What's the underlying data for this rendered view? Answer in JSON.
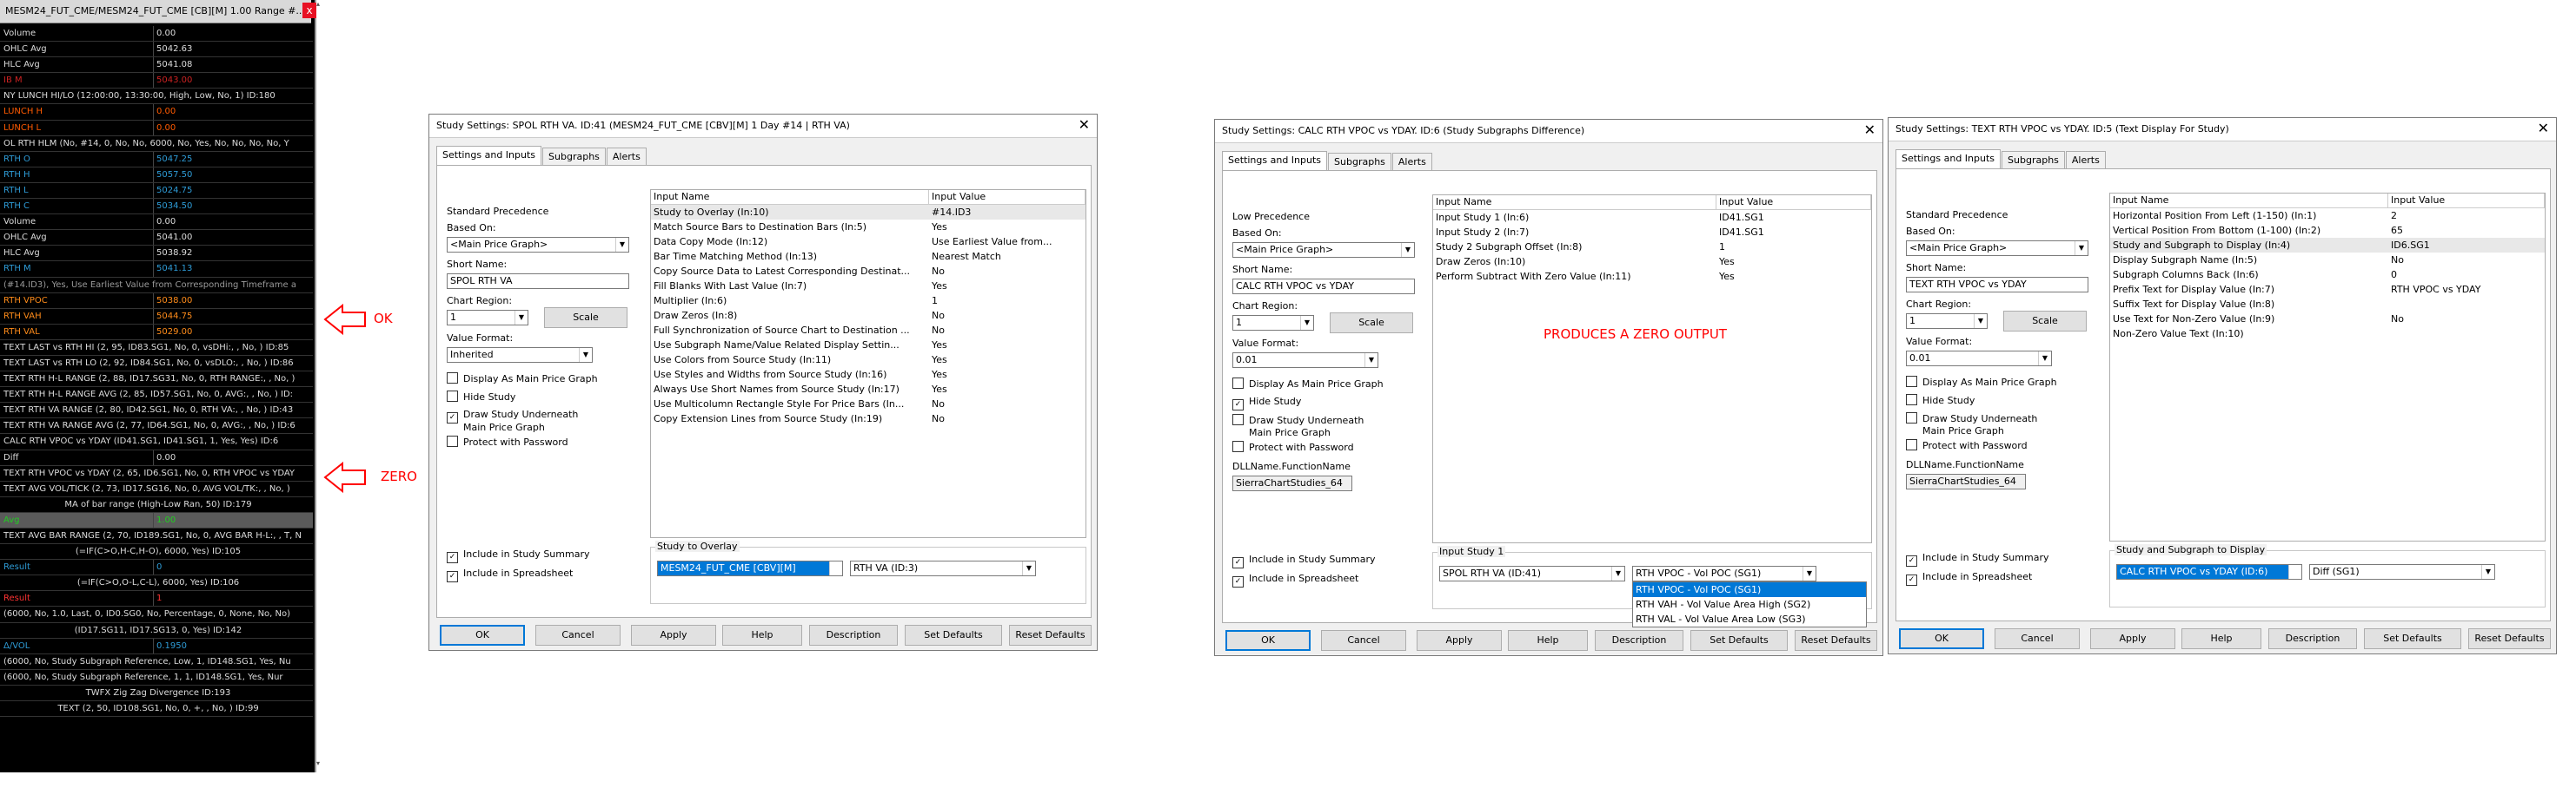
{
  "data_window": {
    "title": "MESM24_FUT_CME/MESM24_FUT_CME [CB][M] 1.00 Range #...",
    "close_label": "x",
    "rows": [
      {
        "name": "Volume",
        "value": "0.00",
        "nc": "#dcdcdc",
        "vc": "#dcdcdc"
      },
      {
        "name": "OHLC Avg",
        "value": "5042.63",
        "nc": "#dcdcdc",
        "vc": "#dcdcdc"
      },
      {
        "name": "HLC Avg",
        "value": "5041.08",
        "nc": "#dcdcdc",
        "vc": "#dcdcdc"
      },
      {
        "name": "IB M",
        "value": "5043.00",
        "nc": "#cc2222",
        "vc": "#cc2222"
      },
      {
        "name": "NY LUNCH HI/LO (12:00:00, 13:30:00, High, Low, No, 1)  ID:180",
        "value": "",
        "nc": "#dcdcdc",
        "vc": "#dcdcdc",
        "full": true
      },
      {
        "name": "LUNCH H",
        "value": "0.00",
        "nc": "#ff5a00",
        "vc": "#ff5a00"
      },
      {
        "name": "LUNCH L",
        "value": "0.00",
        "nc": "#ff5a00",
        "vc": "#ff5a00"
      },
      {
        "name": "OL RTH HLM (No, #14, 0, No, No, 6000, No, Yes, No, No, No, No, Y",
        "value": "",
        "nc": "#dcdcdc",
        "vc": "#dcdcdc",
        "full": true
      },
      {
        "name": "RTH O",
        "value": "5047.25",
        "nc": "#2e9bd6",
        "vc": "#2e9bd6"
      },
      {
        "name": "RTH H",
        "value": "5057.50",
        "nc": "#2e9bd6",
        "vc": "#2e9bd6"
      },
      {
        "name": "RTH L",
        "value": "5024.75",
        "nc": "#2e9bd6",
        "vc": "#2e9bd6"
      },
      {
        "name": "RTH C",
        "value": "5034.50",
        "nc": "#2e9bd6",
        "vc": "#2e9bd6"
      },
      {
        "name": "Volume",
        "value": "0.00",
        "nc": "#dcdcdc",
        "vc": "#dcdcdc"
      },
      {
        "name": "OHLC Avg",
        "value": "5041.00",
        "nc": "#dcdcdc",
        "vc": "#dcdcdc"
      },
      {
        "name": "HLC Avg",
        "value": "5038.92",
        "nc": "#dcdcdc",
        "vc": "#dcdcdc"
      },
      {
        "name": "RTH M",
        "value": "5041.13",
        "nc": "#2e9bd6",
        "vc": "#2e9bd6"
      },
      {
        "name": "(#14.ID3), Yes, Use Earliest Value from Corresponding Timeframe a",
        "value": "",
        "nc": "#9a9a9a",
        "vc": "#9a9a9a",
        "full": true
      },
      {
        "name": "RTH VPOC",
        "value": "5038.00",
        "nc": "#ff8c1a",
        "vc": "#ff8c1a"
      },
      {
        "name": "RTH VAH",
        "value": "5044.75",
        "nc": "#ff8c1a",
        "vc": "#ff8c1a"
      },
      {
        "name": "RTH VAL",
        "value": "5029.00",
        "nc": "#ff8c1a",
        "vc": "#ff8c1a"
      },
      {
        "name": "TEXT LAST vs RTH HI (2, 95, ID83.SG1, No, 0, vsDHi:, , No, )  ID:85",
        "value": "",
        "nc": "#dcdcdc",
        "vc": "#dcdcdc",
        "full": true
      },
      {
        "name": "TEXT LAST vs RTH LO (2, 92, ID84.SG1, No, 0, vsDLO:, , No, )  ID:86",
        "value": "",
        "nc": "#dcdcdc",
        "vc": "#dcdcdc",
        "full": true
      },
      {
        "name": "TEXT RTH H-L RANGE (2, 88, ID17.SG31, No, 0, RTH RANGE:, , No, )",
        "value": "",
        "nc": "#dcdcdc",
        "vc": "#dcdcdc",
        "full": true
      },
      {
        "name": "TEXT RTH H-L RANGE AVG (2, 85, ID57.SG1, No, 0, AVG:, , No, )  ID:",
        "value": "",
        "nc": "#dcdcdc",
        "vc": "#dcdcdc",
        "full": true
      },
      {
        "name": "TEXT RTH VA RANGE (2, 80, ID42.SG1, No, 0, RTH VA:, , No, )  ID:43",
        "value": "",
        "nc": "#dcdcdc",
        "vc": "#dcdcdc",
        "full": true
      },
      {
        "name": "TEXT RTH VA RANGE AVG (2, 77, ID64.SG1, No, 0, AVG:, , No, )  ID:6",
        "value": "",
        "nc": "#dcdcdc",
        "vc": "#dcdcdc",
        "full": true
      },
      {
        "name": "CALC RTH VPOC vs YDAY (ID41.SG1, ID41.SG1, 1, Yes, Yes)  ID:6",
        "value": "",
        "nc": "#dcdcdc",
        "vc": "#dcdcdc",
        "full": true
      },
      {
        "name": "Diff",
        "value": "0.00",
        "nc": "#dcdcdc",
        "vc": "#dcdcdc"
      },
      {
        "name": "TEXT RTH VPOC vs YDAY (2, 65, ID6.SG1, No, 0, RTH VPOC vs YDAY",
        "value": "",
        "nc": "#dcdcdc",
        "vc": "#dcdcdc",
        "full": true
      },
      {
        "name": "TEXT AVG VOL/TICK (2, 73, ID17.SG16, No, 0, AVG VOL/TK:, , No, )",
        "value": "",
        "nc": "#dcdcdc",
        "vc": "#dcdcdc",
        "full": true
      },
      {
        "name": "MA of bar range (High-Low Ran, 50)  ID:179",
        "value": "",
        "nc": "#dcdcdc",
        "vc": "#dcdcdc",
        "full": true,
        "center": true
      },
      {
        "name": "Avg",
        "value": "1.00",
        "nc": "#22cc22",
        "vc": "#22cc22",
        "hlbg": "#5a5a5a"
      },
      {
        "name": "TEXT AVG BAR RANGE (2, 70, ID189.SG1, No, 0, AVG BAR H-L:, , T, N",
        "value": "",
        "nc": "#dcdcdc",
        "vc": "#dcdcdc",
        "full": true
      },
      {
        "name": "(=IF(C>O,H-C,H-O), 6000, Yes)  ID:105",
        "value": "",
        "nc": "#dcdcdc",
        "vc": "#dcdcdc",
        "full": true,
        "center": true
      },
      {
        "name": "Result",
        "value": "0",
        "nc": "#2e9bd6",
        "vc": "#2e9bd6"
      },
      {
        "name": "(=IF(C>O,O-L,C-L), 6000, Yes)  ID:106",
        "value": "",
        "nc": "#dcdcdc",
        "vc": "#dcdcdc",
        "full": true,
        "center": true
      },
      {
        "name": "Result",
        "value": "1",
        "nc": "#ff3333",
        "vc": "#ff3333"
      },
      {
        "name": "(6000, No, 1.0, Last, 0, ID0.SG0, No, Percentage, 0, None, No, No)",
        "value": "",
        "nc": "#dcdcdc",
        "vc": "#dcdcdc",
        "full": true
      },
      {
        "name": "(ID17.SG11, ID17.SG13, 0, Yes)  ID:142",
        "value": "",
        "nc": "#dcdcdc",
        "vc": "#dcdcdc",
        "full": true,
        "center": true
      },
      {
        "name": "Δ/VOL",
        "value": "0.1950",
        "nc": "#2e9bd6",
        "vc": "#2e9bd6"
      },
      {
        "name": "(6000, No, Study Subgraph Reference, Low, 1, ID148.SG1, Yes, Nu",
        "value": "",
        "nc": "#dcdcdc",
        "vc": "#dcdcdc",
        "full": true
      },
      {
        "name": "(6000, No, Study Subgraph Reference, 1, 1, ID148.SG1, Yes, Nur",
        "value": "",
        "nc": "#dcdcdc",
        "vc": "#dcdcdc",
        "full": true
      },
      {
        "name": "TWFX Zig Zag Divergence  ID:193",
        "value": "",
        "nc": "#dcdcdc",
        "vc": "#dcdcdc",
        "full": true,
        "center": true
      },
      {
        "name": "TEXT  (2, 50, ID108.SG1, No, 0, +, , No, )  ID:99",
        "value": "",
        "nc": "#dcdcdc",
        "vc": "#dcdcdc",
        "full": true,
        "center": true
      }
    ]
  },
  "annotations": {
    "ok": "OK",
    "zero": "ZERO",
    "produces_zero": "PRODUCES A ZERO OUTPUT"
  },
  "dialog1": {
    "title": "Study Settings: SPOL RTH VA. ID:41 (MESM24_FUT_CME [CBV][M]  1 Day  #14 | RTH VA)",
    "tabs": [
      "Settings and Inputs",
      "Subgraphs",
      "Alerts"
    ],
    "precedence": "Standard Precedence",
    "based_on_label": "Based On:",
    "based_on": "<Main Price Graph>",
    "short_name_label": "Short Name:",
    "short_name": "SPOL RTH VA",
    "chart_region_label": "Chart Region:",
    "chart_region": "1",
    "scale": "Scale",
    "value_format_label": "Value Format:",
    "value_format": "Inherited",
    "checks": [
      {
        "label": "Display As Main Price Graph",
        "checked": ""
      },
      {
        "label": "Hide Study",
        "checked": ""
      },
      {
        "label": "Draw Study Underneath",
        "checked": "✓"
      },
      {
        "label": "Protect with Password",
        "checked": ""
      }
    ],
    "check_cont": "Main Price Graph",
    "bottom_checks": [
      {
        "label": "Include in Study Summary",
        "checked": "✓"
      },
      {
        "label": "Include in Spreadsheet",
        "checked": "✓"
      }
    ],
    "grid_headers": [
      "Input Name",
      "Input Value"
    ],
    "rows": [
      [
        "Study to Overlay   (In:10)",
        "#14.ID3"
      ],
      [
        "Match Source Bars to Destination Bars   (In:5)",
        "Yes"
      ],
      [
        "Data Copy Mode   (In:12)",
        "Use Earliest Value from..."
      ],
      [
        "Bar Time Matching Method   (In:13)",
        "Nearest Match"
      ],
      [
        "Copy Source Data to Latest Corresponding Destinat...",
        "No"
      ],
      [
        "Fill Blanks With Last Value   (In:7)",
        "Yes"
      ],
      [
        "Multiplier   (In:6)",
        "1"
      ],
      [
        "Draw Zeros   (In:8)",
        "No"
      ],
      [
        "Full Synchronization of Source Chart to Destination ...",
        "No"
      ],
      [
        "Use Subgraph Name/Value Related Display Settin...",
        "Yes"
      ],
      [
        "Use Colors from Source Study   (In:11)",
        "Yes"
      ],
      [
        "Use Styles and Widths from Source Study   (In:16)",
        "Yes"
      ],
      [
        "Always Use Short Names from Source Study   (In:17)",
        "Yes"
      ],
      [
        "Use Multicolumn Rectangle Style For Price Bars   (In...",
        "No"
      ],
      [
        "Copy Extension Lines from Source Study   (In:19)",
        "No"
      ]
    ],
    "group_label": "Study to Overlay",
    "group_combo1": "MESM24_FUT_CME [CBV][M]",
    "group_combo2": "RTH VA (ID:3)",
    "buttons": [
      "OK",
      "Cancel",
      "Apply",
      "Help",
      "Description",
      "Set Defaults",
      "Reset Defaults"
    ]
  },
  "dialog2": {
    "title": "Study Settings: CALC RTH VPOC vs YDAY. ID:6 (Study Subgraphs Difference)",
    "tabs": [
      "Settings and Inputs",
      "Subgraphs",
      "Alerts"
    ],
    "precedence": "Low Precedence",
    "based_on_label": "Based On:",
    "based_on": "<Main Price Graph>",
    "short_name_label": "Short Name:",
    "short_name": "CALC RTH VPOC vs YDAY",
    "chart_region_label": "Chart Region:",
    "chart_region": "1",
    "scale": "Scale",
    "value_format_label": "Value Format:",
    "value_format": "0.01",
    "checks": [
      {
        "label": "Display As Main Price Graph",
        "checked": ""
      },
      {
        "label": "Hide Study",
        "checked": "✓"
      },
      {
        "label": "Draw Study Underneath",
        "checked": ""
      },
      {
        "label": "Protect with Password",
        "checked": ""
      }
    ],
    "check_cont": "Main Price Graph",
    "dll_label": "DLLName.FunctionName",
    "dll": "SierraChartStudies_64",
    "bottom_checks": [
      {
        "label": "Include in Study Summary",
        "checked": "✓"
      },
      {
        "label": "Include in Spreadsheet",
        "checked": "✓"
      }
    ],
    "grid_headers": [
      "Input Name",
      "Input Value"
    ],
    "rows": [
      [
        "Input Study 1   (In:6)",
        "ID41.SG1"
      ],
      [
        "Input Study 2   (In:7)",
        "ID41.SG1"
      ],
      [
        "Study 2 Subgraph Offset   (In:8)",
        "1"
      ],
      [
        "Draw Zeros   (In:10)",
        "Yes"
      ],
      [
        "Perform Subtract With Zero Value   (In:11)",
        "Yes"
      ]
    ],
    "group_label": "Input Study 1",
    "group_combo1": "SPOL RTH VA (ID:41)",
    "group_combo2": "RTH VPOC - Vol POC (SG1)",
    "dropdown": [
      "RTH VPOC - Vol POC (SG1)",
      "RTH VAH - Vol Value Area High (SG2)",
      "RTH VAL - Vol Value Area Low (SG3)"
    ],
    "buttons": [
      "OK",
      "Cancel",
      "Apply",
      "Help",
      "Description",
      "Set Defaults",
      "Reset Defaults"
    ]
  },
  "dialog3": {
    "title": "Study Settings: TEXT RTH VPOC vs YDAY. ID:5 (Text Display For Study)",
    "tabs": [
      "Settings and Inputs",
      "Subgraphs",
      "Alerts"
    ],
    "precedence": "Standard Precedence",
    "based_on_label": "Based On:",
    "based_on": "<Main Price Graph>",
    "short_name_label": "Short Name:",
    "short_name": "TEXT RTH VPOC vs YDAY",
    "chart_region_label": "Chart Region:",
    "chart_region": "1",
    "scale": "Scale",
    "value_format_label": "Value Format:",
    "value_format": "0.01",
    "checks": [
      {
        "label": "Display As Main Price Graph",
        "checked": ""
      },
      {
        "label": "Hide Study",
        "checked": ""
      },
      {
        "label": "Draw Study Underneath",
        "checked": ""
      },
      {
        "label": "Protect with Password",
        "checked": ""
      }
    ],
    "check_cont": "Main Price Graph",
    "dll_label": "DLLName.FunctionName",
    "dll": "SierraChartStudies_64",
    "bottom_checks": [
      {
        "label": "Include in Study Summary",
        "checked": "✓"
      },
      {
        "label": "Include in Spreadsheet",
        "checked": "✓"
      }
    ],
    "grid_headers": [
      "Input Name",
      "Input Value"
    ],
    "rows": [
      [
        "Horizontal Position From Left (1-150)   (In:1)",
        "2"
      ],
      [
        "Vertical Position From Bottom (1-100)   (In:2)",
        "65"
      ],
      [
        "Study and Subgraph to Display   (In:4)",
        "ID6.SG1"
      ],
      [
        "Display Subgraph Name   (In:5)",
        "No"
      ],
      [
        "Subgraph Columns Back   (In:6)",
        "0"
      ],
      [
        "Prefix Text for Display Value   (In:7)",
        "RTH VPOC vs YDAY"
      ],
      [
        "Suffix Text for Display Value   (In:8)",
        ""
      ],
      [
        "Use Text for Non-Zero Value   (In:9)",
        "No"
      ],
      [
        "Non-Zero Value Text   (In:10)",
        ""
      ]
    ],
    "group_label": "Study and Subgraph to Display",
    "group_combo1": "CALC RTH VPOC vs YDAY (ID:6)",
    "group_combo2": "Diff (SG1)",
    "buttons": [
      "OK",
      "Cancel",
      "Apply",
      "Help",
      "Description",
      "Set Defaults",
      "Reset Defaults"
    ]
  }
}
